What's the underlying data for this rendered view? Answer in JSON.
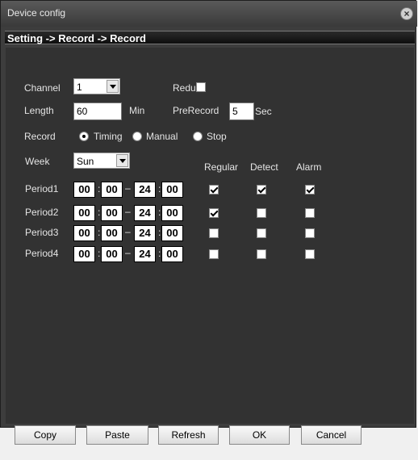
{
  "window": {
    "title": "Device config"
  },
  "breadcrumb": "Setting -> Record -> Record",
  "form": {
    "channel_label": "Channel",
    "channel_value": "1",
    "redu_label": "Redu",
    "redu_checked": false,
    "length_label": "Length",
    "length_value": "60",
    "length_unit": "Min",
    "prerecord_label": "PreRecord",
    "prerecord_value": "5",
    "prerecord_unit": "Sec",
    "record_label": "Record",
    "record_modes": [
      {
        "label": "Timing",
        "selected": true
      },
      {
        "label": "Manual",
        "selected": false
      },
      {
        "label": "Stop",
        "selected": false
      }
    ],
    "week_label": "Week",
    "week_value": "Sun"
  },
  "columns": {
    "regular": "Regular",
    "detect": "Detect",
    "alarm": "Alarm"
  },
  "periods": [
    {
      "label": "Period1",
      "start_h": "00",
      "start_m": "00",
      "end_h": "24",
      "end_m": "00",
      "regular": true,
      "detect": true,
      "alarm": true
    },
    {
      "label": "Period2",
      "start_h": "00",
      "start_m": "00",
      "end_h": "24",
      "end_m": "00",
      "regular": true,
      "detect": false,
      "alarm": false
    },
    {
      "label": "Period3",
      "start_h": "00",
      "start_m": "00",
      "end_h": "24",
      "end_m": "00",
      "regular": false,
      "detect": false,
      "alarm": false
    },
    {
      "label": "Period4",
      "start_h": "00",
      "start_m": "00",
      "end_h": "24",
      "end_m": "00",
      "regular": false,
      "detect": false,
      "alarm": false
    }
  ],
  "time_sep": ":",
  "range_sep": "–",
  "buttons": {
    "copy": "Copy",
    "paste": "Paste",
    "refresh": "Refresh",
    "ok": "OK",
    "cancel": "Cancel"
  }
}
